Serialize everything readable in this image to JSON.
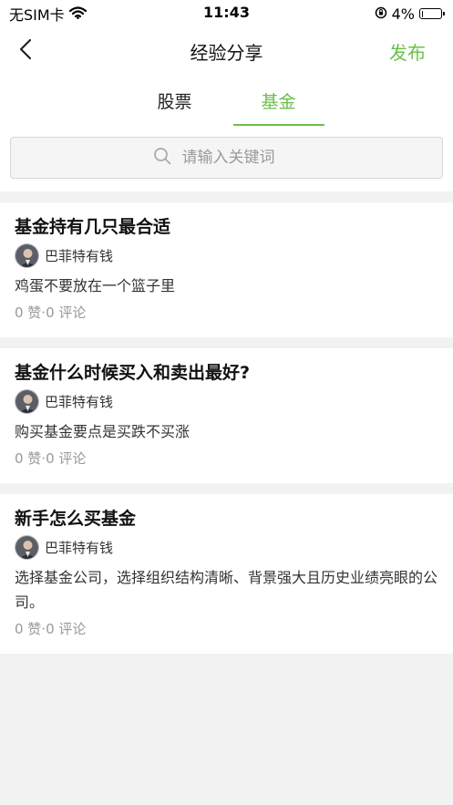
{
  "status": {
    "carrier": "无SIM卡",
    "time": "11:43",
    "battery": "4%",
    "battery_level": 0.04
  },
  "nav": {
    "title": "经验分享",
    "publish": "发布",
    "back_icon": "chevron-left-icon"
  },
  "tabs": [
    {
      "label": "股票",
      "active": false
    },
    {
      "label": "基金",
      "active": true
    }
  ],
  "search": {
    "placeholder": "请输入关键词",
    "icon": "search-icon"
  },
  "accent_color": "#6cc04a",
  "posts": [
    {
      "title": "基金持有几只最合适",
      "author": "巴菲特有钱",
      "summary": "鸡蛋不要放在一个篮子里",
      "stats": "0 赞·0 评论"
    },
    {
      "title": "基金什么时候买入和卖出最好?",
      "author": "巴菲特有钱",
      "summary": "购买基金要点是买跌不买涨",
      "stats": "0 赞·0 评论"
    },
    {
      "title": "新手怎么买基金",
      "author": "巴菲特有钱",
      "summary": "选择基金公司，选择组织结构清晰、背景强大且历史业绩亮眼的公司。",
      "stats": "0 赞·0 评论"
    }
  ]
}
